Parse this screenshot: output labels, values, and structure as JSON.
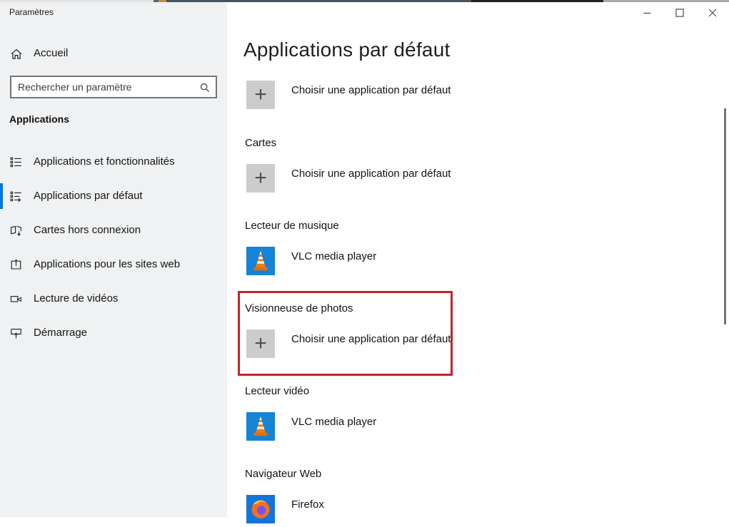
{
  "window": {
    "app_title": "Paramètres",
    "controls": [
      "minimize",
      "maximize",
      "close"
    ]
  },
  "sidebar": {
    "home_label": "Accueil",
    "search_placeholder": "Rechercher un paramètre",
    "section_header": "Applications",
    "accent_color": "#0078d7",
    "items": [
      {
        "label": "Applications et fonctionnalités",
        "icon": "apps-features-icon",
        "selected": false
      },
      {
        "label": "Applications par défaut",
        "icon": "default-apps-icon",
        "selected": true
      },
      {
        "label": "Cartes hors connexion",
        "icon": "offline-maps-icon",
        "selected": false
      },
      {
        "label": "Applications pour les sites web",
        "icon": "website-apps-icon",
        "selected": false
      },
      {
        "label": "Lecture de vidéos",
        "icon": "video-playback-icon",
        "selected": false
      },
      {
        "label": "Démarrage",
        "icon": "startup-icon",
        "selected": false
      }
    ]
  },
  "main": {
    "title": "Applications par défaut",
    "sections": [
      {
        "category": "",
        "app": "Choisir une application par défaut",
        "icon": "plus-icon",
        "highlighted": false
      },
      {
        "category": "Cartes",
        "app": "Choisir une application par défaut",
        "icon": "plus-icon",
        "highlighted": false
      },
      {
        "category": "Lecteur de musique",
        "app": "VLC media player",
        "icon": "vlc-icon",
        "highlighted": false
      },
      {
        "category": "Visionneuse de photos",
        "app": "Choisir une application par défaut",
        "icon": "plus-icon",
        "highlighted": true
      },
      {
        "category": "Lecteur vidéo",
        "app": "VLC media player",
        "icon": "vlc-icon",
        "highlighted": false
      },
      {
        "category": "Navigateur Web",
        "app": "Firefox",
        "icon": "firefox-icon",
        "highlighted": false
      }
    ],
    "plus_glyph": "+",
    "highlight_border_color": "#c2242c"
  }
}
